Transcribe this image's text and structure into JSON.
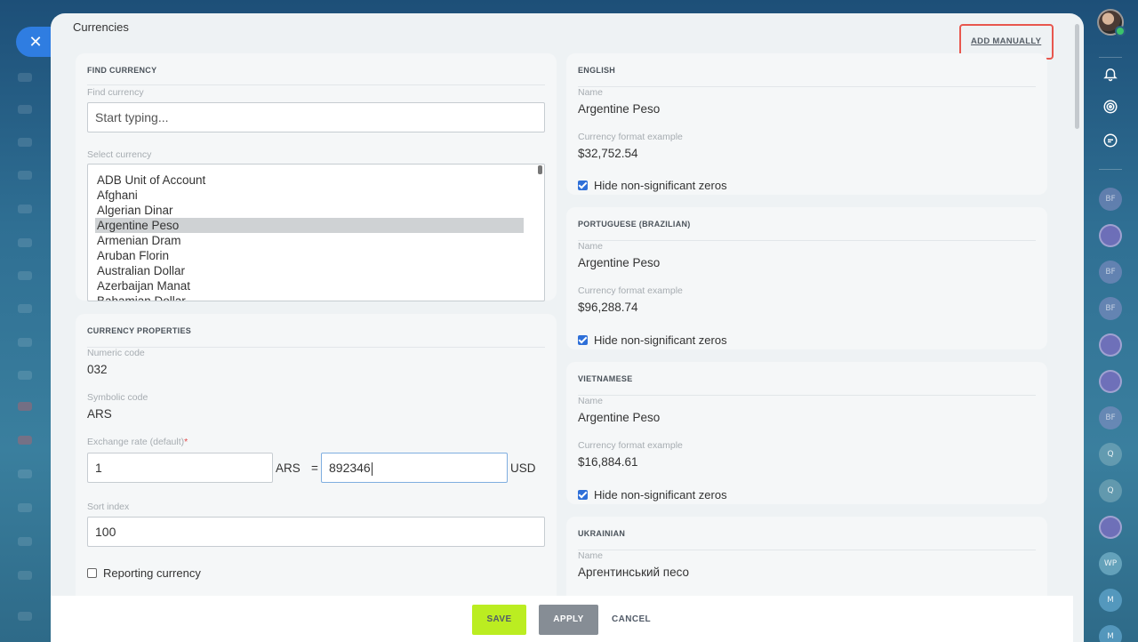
{
  "dialog": {
    "title": "Currencies",
    "add_manually": "ADD MANUALLY",
    "close_icon": "close-icon"
  },
  "find": {
    "section_title": "FIND CURRENCY",
    "search_label": "Find currency",
    "search_placeholder": "Start typing...",
    "select_label": "Select currency",
    "items": [
      {
        "label": "ADB Unit of Account",
        "selected": false
      },
      {
        "label": "Afghani",
        "selected": false
      },
      {
        "label": "Algerian Dinar",
        "selected": false
      },
      {
        "label": "Argentine Peso",
        "selected": true
      },
      {
        "label": "Armenian Dram",
        "selected": false
      },
      {
        "label": "Aruban Florin",
        "selected": false
      },
      {
        "label": "Australian Dollar",
        "selected": false
      },
      {
        "label": "Azerbaijan Manat",
        "selected": false
      },
      {
        "label": "Bahamian Dollar",
        "selected": false
      }
    ]
  },
  "properties": {
    "section_title": "CURRENCY PROPERTIES",
    "numeric_label": "Numeric code",
    "numeric_value": "032",
    "symbolic_label": "Symbolic code",
    "symbolic_value": "ARS",
    "rate_label": "Exchange rate (default)",
    "required_mark": "*",
    "rate_left_value": "1",
    "rate_left_unit": "ARS",
    "equals": "=",
    "rate_right_value": "892346",
    "rate_right_unit": "USD",
    "sort_label": "Sort index",
    "sort_value": "100",
    "reporting_label": "Reporting currency",
    "reporting_checked": false
  },
  "languages": [
    {
      "title": "ENGLISH",
      "name_label": "Name",
      "name": "Argentine Peso",
      "format_label": "Currency format example",
      "format": "$32,752.54",
      "hide_zeros_label": "Hide non-significant zeros",
      "hide_zeros": true
    },
    {
      "title": "PORTUGUESE (BRAZILIAN)",
      "name_label": "Name",
      "name": "Argentine Peso",
      "format_label": "Currency format example",
      "format": "$96,288.74",
      "hide_zeros_label": "Hide non-significant zeros",
      "hide_zeros": true
    },
    {
      "title": "VIETNAMESE",
      "name_label": "Name",
      "name": "Argentine Peso",
      "format_label": "Currency format example",
      "format": "$16,884.61",
      "hide_zeros_label": "Hide non-significant zeros",
      "hide_zeros": true
    },
    {
      "title": "UKRAINIAN",
      "name_label": "Name",
      "name": "Аргентинський песо"
    }
  ],
  "footer": {
    "save": "SAVE",
    "apply": "APPLY",
    "cancel": "CANCEL"
  },
  "right_sidebar": {
    "icons": [
      "bell-icon",
      "copilot-icon",
      "chat-icon"
    ],
    "contacts": [
      "BF",
      "",
      "BF",
      "BF",
      "",
      "",
      "BF",
      "Q",
      "Q",
      "",
      "WP",
      "M",
      "M"
    ]
  },
  "colors": {
    "accent": "#2f7de1",
    "save_button": "#bbed21",
    "apply_button": "#868d95",
    "highlight_box": "#e8574e",
    "checkbox": "#2e6fd8"
  }
}
